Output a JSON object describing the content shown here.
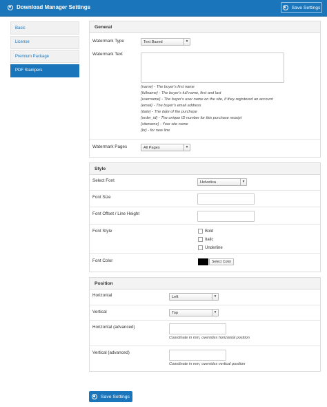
{
  "header": {
    "title": "Download Manager Settings",
    "save_label": "Save Settings"
  },
  "sidebar": {
    "items": [
      {
        "label": "Basic"
      },
      {
        "label": "License"
      },
      {
        "label": "Premium Package"
      },
      {
        "label": "PDF Stampers"
      }
    ],
    "active_index": 3
  },
  "general": {
    "title": "General",
    "watermark_type_label": "Watermark Type",
    "watermark_type_value": "Text Based",
    "watermark_text_label": "Watermark Text",
    "watermark_text_value": "",
    "placeholders": [
      "{name} - The buyer's first name",
      "{fullname} - The buyer's full name, first and last",
      "{username} - The buyer's user name on the site, if they registered an account",
      "{email} - The buyer's email address",
      "{date} - The date of the purchase",
      "{order_id} - The unique ID number for this purchase receipt",
      "{sitename} - Your site name",
      "{br} - for new line"
    ],
    "watermark_pages_label": "Watermark Pages",
    "watermark_pages_value": "All Pages"
  },
  "style": {
    "title": "Style",
    "select_font_label": "Select Font",
    "select_font_value": "Helvetica",
    "font_size_label": "Font Size",
    "font_size_value": "",
    "font_offset_label": "Font Offset / Line Height",
    "font_offset_value": "",
    "font_style_label": "Font Style",
    "font_style_options": [
      "Bold",
      "Italic",
      "Underline"
    ],
    "font_color_label": "Font Color",
    "font_color_value": "#000000",
    "select_color_label": "Select Color"
  },
  "position": {
    "title": "Position",
    "horizontal_label": "Horizontal",
    "horizontal_value": "Left",
    "vertical_label": "Vertical",
    "vertical_value": "Top",
    "horizontal_adv_label": "Horizontal (advanced)",
    "horizontal_adv_hint": "Coordinate in mm, overrides horizontal position",
    "vertical_adv_label": "Vertical (advanced)",
    "vertical_adv_hint": "Coordinate in mm, overrides vertical position"
  },
  "colors": {
    "brand": "#1a75bb",
    "panel_header": "#f3f3f3"
  },
  "icons": {
    "save": "gear-icon",
    "select_arrow": "chevron-down-icon"
  }
}
